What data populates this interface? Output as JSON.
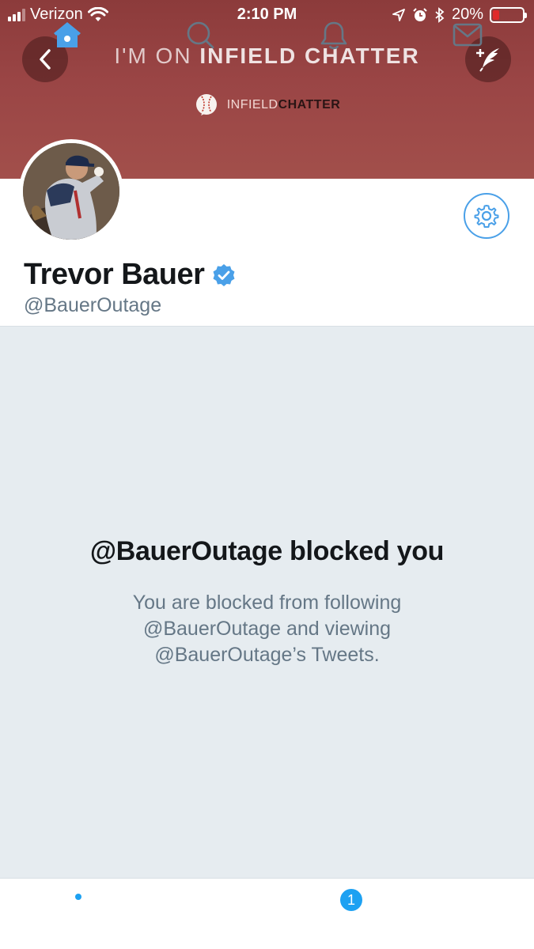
{
  "status_bar": {
    "carrier": "Verizon",
    "time": "2:10 PM",
    "battery": "20%",
    "battery_level": 0.2
  },
  "header": {
    "title_prefix": "I'M ON",
    "title_brand": "INFIELD CHATTER",
    "logo_light": "INFIELD",
    "logo_dark": "CHATTER"
  },
  "profile": {
    "name": "Trevor Bauer",
    "handle": "@BauerOutage",
    "verified": true
  },
  "blocked": {
    "title": "@BauerOutage blocked you",
    "description": "You are blocked from following @BauerOutage and viewing @BauerOutage’s Tweets."
  },
  "tabbar": {
    "notification_count": "1"
  },
  "colors": {
    "banner": "#9a4545",
    "accent": "#1da1f2",
    "background": "#e6ecf0"
  }
}
